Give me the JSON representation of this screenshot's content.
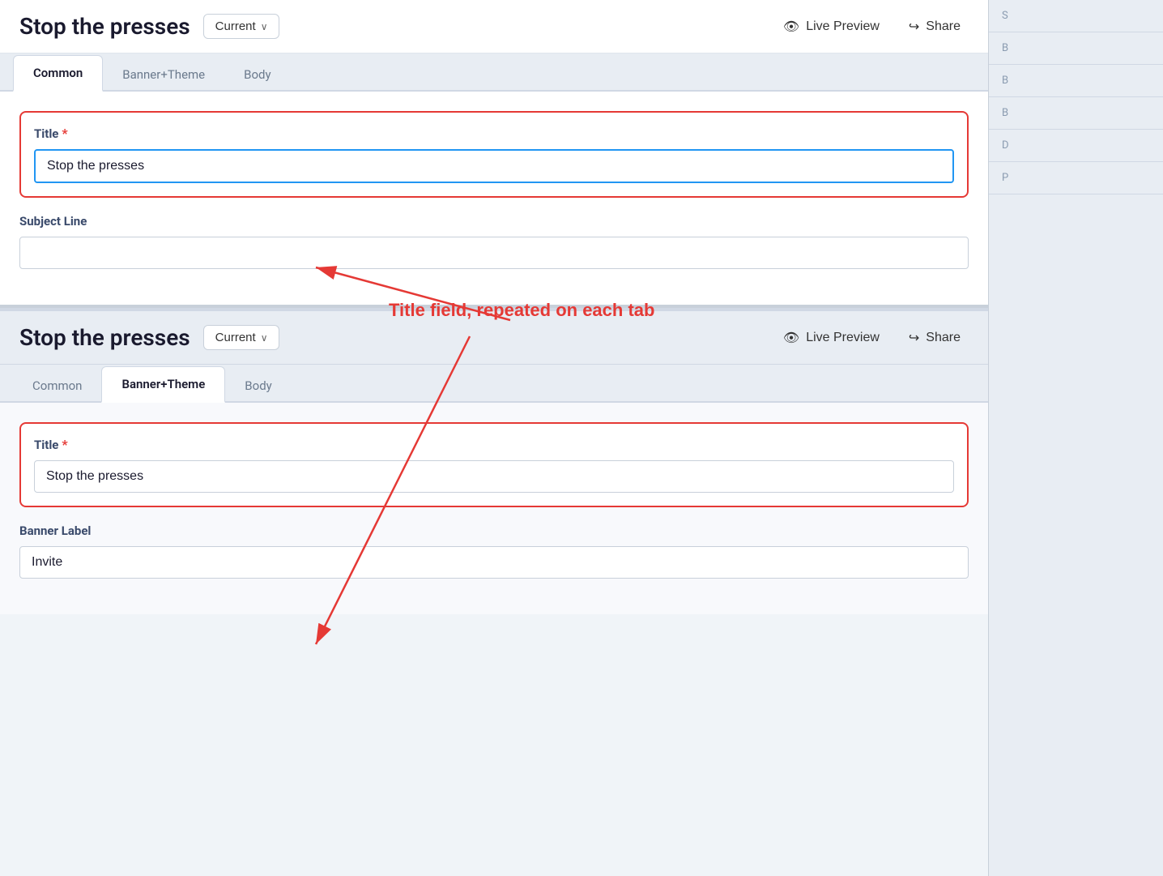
{
  "page": {
    "title": "Stop the presses"
  },
  "panel1": {
    "title": "Stop the presses",
    "version_label": "Current",
    "live_preview_label": "Live Preview",
    "share_label": "Share",
    "tabs": [
      {
        "id": "common",
        "label": "Common",
        "active": true
      },
      {
        "id": "banner-theme",
        "label": "Banner+Theme",
        "active": false
      },
      {
        "id": "body",
        "label": "Body",
        "active": false
      }
    ],
    "title_field": {
      "label": "Title",
      "required": true,
      "value": "Stop the presses",
      "placeholder": ""
    },
    "subject_field": {
      "label": "Subject Line",
      "required": false,
      "value": "",
      "placeholder": ""
    }
  },
  "panel2": {
    "title": "Stop the presses",
    "version_label": "Current",
    "live_preview_label": "Live Preview",
    "share_label": "Share",
    "tabs": [
      {
        "id": "common",
        "label": "Common",
        "active": false
      },
      {
        "id": "banner-theme",
        "label": "Banner+Theme",
        "active": true
      },
      {
        "id": "body",
        "label": "Body",
        "active": false
      }
    ],
    "title_field": {
      "label": "Title",
      "required": true,
      "value": "Stop the presses",
      "placeholder": ""
    },
    "banner_label_field": {
      "label": "Banner Label",
      "required": false,
      "value": "Invite",
      "placeholder": ""
    }
  },
  "annotation": {
    "text": "Title field, repeated on each tab"
  },
  "sidebar": {
    "items": [
      "S",
      "B",
      "B"
    ]
  },
  "icons": {
    "eye": "👁",
    "share": "↪",
    "chevron": "∨"
  }
}
